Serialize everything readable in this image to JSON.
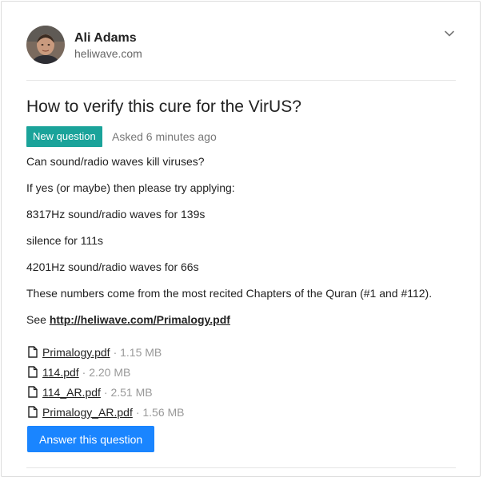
{
  "author": {
    "name": "Ali Adams",
    "site": "heliwave.com"
  },
  "question": {
    "title": "How to verify this cure for the VirUS?",
    "badge": "New question",
    "asked": "Asked 6 minutes ago",
    "paragraphs": [
      "Can sound/radio waves kill viruses?",
      "If yes (or maybe) then please try applying:",
      "8317Hz sound/radio waves for 139s",
      "silence for 111s",
      "4201Hz sound/radio waves for 66s",
      "These numbers come from the most recited Chapters of the Quran (#1 and #112)."
    ],
    "see_prefix": "See ",
    "see_link": "http://heliwave.com/Primalogy.pdf"
  },
  "attachments": [
    {
      "name": "Primalogy.pdf",
      "size": "· 1.15 MB"
    },
    {
      "name": "114.pdf",
      "size": "· 2.20 MB"
    },
    {
      "name": "114_AR.pdf",
      "size": "· 2.51 MB"
    },
    {
      "name": "Primalogy_AR.pdf",
      "size": "· 1.56 MB"
    }
  ],
  "actions": {
    "answer_label": "Answer this question"
  },
  "colors": {
    "badge": "#1aa39a",
    "button": "#1a85ff"
  },
  "icons": {
    "menu": "chevron-down-icon",
    "file": "file-icon"
  }
}
